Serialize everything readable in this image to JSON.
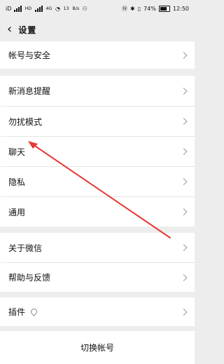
{
  "status_bar": {
    "carrier_left": "iD",
    "net_small_1": "HD",
    "net_small_2": "4G",
    "speed_top": "13",
    "speed_bottom": "B/s",
    "battery_percent": "74%",
    "time": "12:50"
  },
  "header": {
    "back_icon": "chevron-left",
    "title": "设置"
  },
  "items": {
    "account_security": "帐号与安全",
    "new_message_alert": "新消息提醒",
    "do_not_disturb": "勿扰模式",
    "chat": "聊天",
    "privacy": "隐私",
    "general": "通用",
    "about_wechat": "关于微信",
    "help_feedback": "帮助与反馈",
    "plugins": "插件"
  },
  "footer": {
    "switch_account": "切换帐号"
  },
  "annotation": {
    "arrow_color": "#e53935"
  }
}
